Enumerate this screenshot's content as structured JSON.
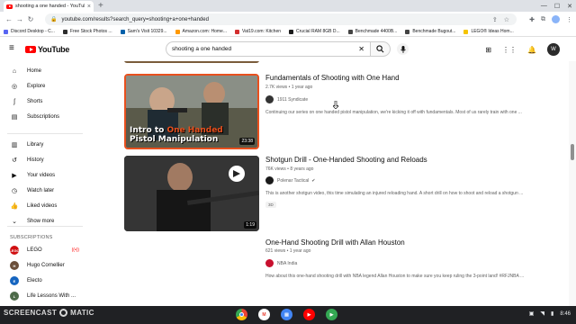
{
  "browser": {
    "tab_title": "shooting a one handed - YouTube",
    "tab_close": "×",
    "new_tab": "+",
    "url": "youtube.com/results?search_query=shooting+a+one+handed",
    "bookmarks": [
      {
        "label": "Discord Desktop - C...",
        "color": "#5865f2"
      },
      {
        "label": "Free Stock Photos ...",
        "color": "#2d2d2d"
      },
      {
        "label": "Sam's Visit 10329...",
        "color": "#0060a9"
      },
      {
        "label": "Amazon.com: Home...",
        "color": "#ff9900"
      },
      {
        "label": "Vat19.com: Kitchen",
        "color": "#d32f2f"
      },
      {
        "label": "Crucial RAM 8GB D...",
        "color": "#1b1b1b"
      },
      {
        "label": "Benchmade 4400B...",
        "color": "#444444"
      },
      {
        "label": "Benchmade Bugout...",
        "color": "#444444"
      },
      {
        "label": "LEGO® Ideas Hom...",
        "color": "#f5c400"
      }
    ]
  },
  "masthead": {
    "logo_text": "YouTube",
    "search_query": "shooting a one handed",
    "avatar_letter": "W"
  },
  "sidebar": {
    "items": [
      {
        "label": "Home",
        "icon": "⌂",
        "name": "home"
      },
      {
        "label": "Explore",
        "icon": "◎",
        "name": "explore"
      },
      {
        "label": "Shorts",
        "icon": "ʃ",
        "name": "shorts"
      },
      {
        "label": "Subscriptions",
        "icon": "▤",
        "name": "subscriptions"
      },
      {
        "label": "Library",
        "icon": "▥",
        "name": "library"
      },
      {
        "label": "History",
        "icon": "↺",
        "name": "history"
      },
      {
        "label": "Your videos",
        "icon": "▶",
        "name": "your-videos"
      },
      {
        "label": "Watch later",
        "icon": "◷",
        "name": "watch-later"
      },
      {
        "label": "Liked videos",
        "icon": "👍",
        "name": "liked-videos"
      },
      {
        "label": "Show more",
        "icon": "⌄",
        "name": "show-more"
      }
    ],
    "subscriptions_heading": "SUBSCRIPTIONS",
    "subscriptions": [
      {
        "label": "LEGO",
        "color": "#d01012",
        "initial": "LEGO",
        "live": "((•))"
      },
      {
        "label": "Hugo Cornellier",
        "color": "#6b4f3a",
        "initial": "H"
      },
      {
        "label": "Electo",
        "color": "#1565c0",
        "initial": "E"
      },
      {
        "label": "Life Lessons With ...",
        "color": "#4e6b4a",
        "initial": "L"
      }
    ]
  },
  "results": [
    {
      "title": "Fundamentals of Shooting with One Hand",
      "meta": "2.7K views • 1 year ago",
      "channel": "1911 Syndicate",
      "channel_color": "#333333",
      "description": "Continuing our series on one handed pistol manipulation, we're kicking it off with fundamentals. Most of us rarely train with one ...",
      "duration": "23:38",
      "thumb_text_1": "Intro to",
      "thumb_text_hl": "One Handed",
      "thumb_text_2": "Pistol Manipulation"
    },
    {
      "title": "Shotgun Drill - One-Handed Shooting and Reloads",
      "meta": "76K views • 8 years ago",
      "channel": "Polenar Tactical",
      "channel_color": "#1a1a1a",
      "verified": "✔",
      "description": "This is another shotgun video, this time simulating an injured reloading hand. A short drill on how to shoot and reload a shotgun ...",
      "badge": "3D",
      "duration": "1:19"
    },
    {
      "title": "One-Hand Shooting Drill with Allan Houston",
      "meta": "621 views • 1 year ago",
      "channel": "NBA India",
      "channel_color": "#c8102e",
      "description": "How about this one-hand shooting drill with NBA legend Allan Houston to make sure you keep ruling the 3-point land! #RFJNBA ..."
    }
  ],
  "taskbar": {
    "watermark_left": "SCREENCAST",
    "watermark_right": "MATIC",
    "apps": [
      {
        "name": "chrome",
        "color": "#4285f4",
        "label": ""
      },
      {
        "name": "gmail",
        "color": "#ffffff",
        "label": "M"
      },
      {
        "name": "docs",
        "color": "#4285f4",
        "label": "▤"
      },
      {
        "name": "youtube",
        "color": "#ff0000",
        "label": "▶"
      },
      {
        "name": "play-store",
        "color": "#34a853",
        "label": "▶"
      }
    ],
    "time": "8:46"
  },
  "colors": {
    "youtube_red": "#ff0000",
    "thumb_highlight": "#e8501e"
  }
}
